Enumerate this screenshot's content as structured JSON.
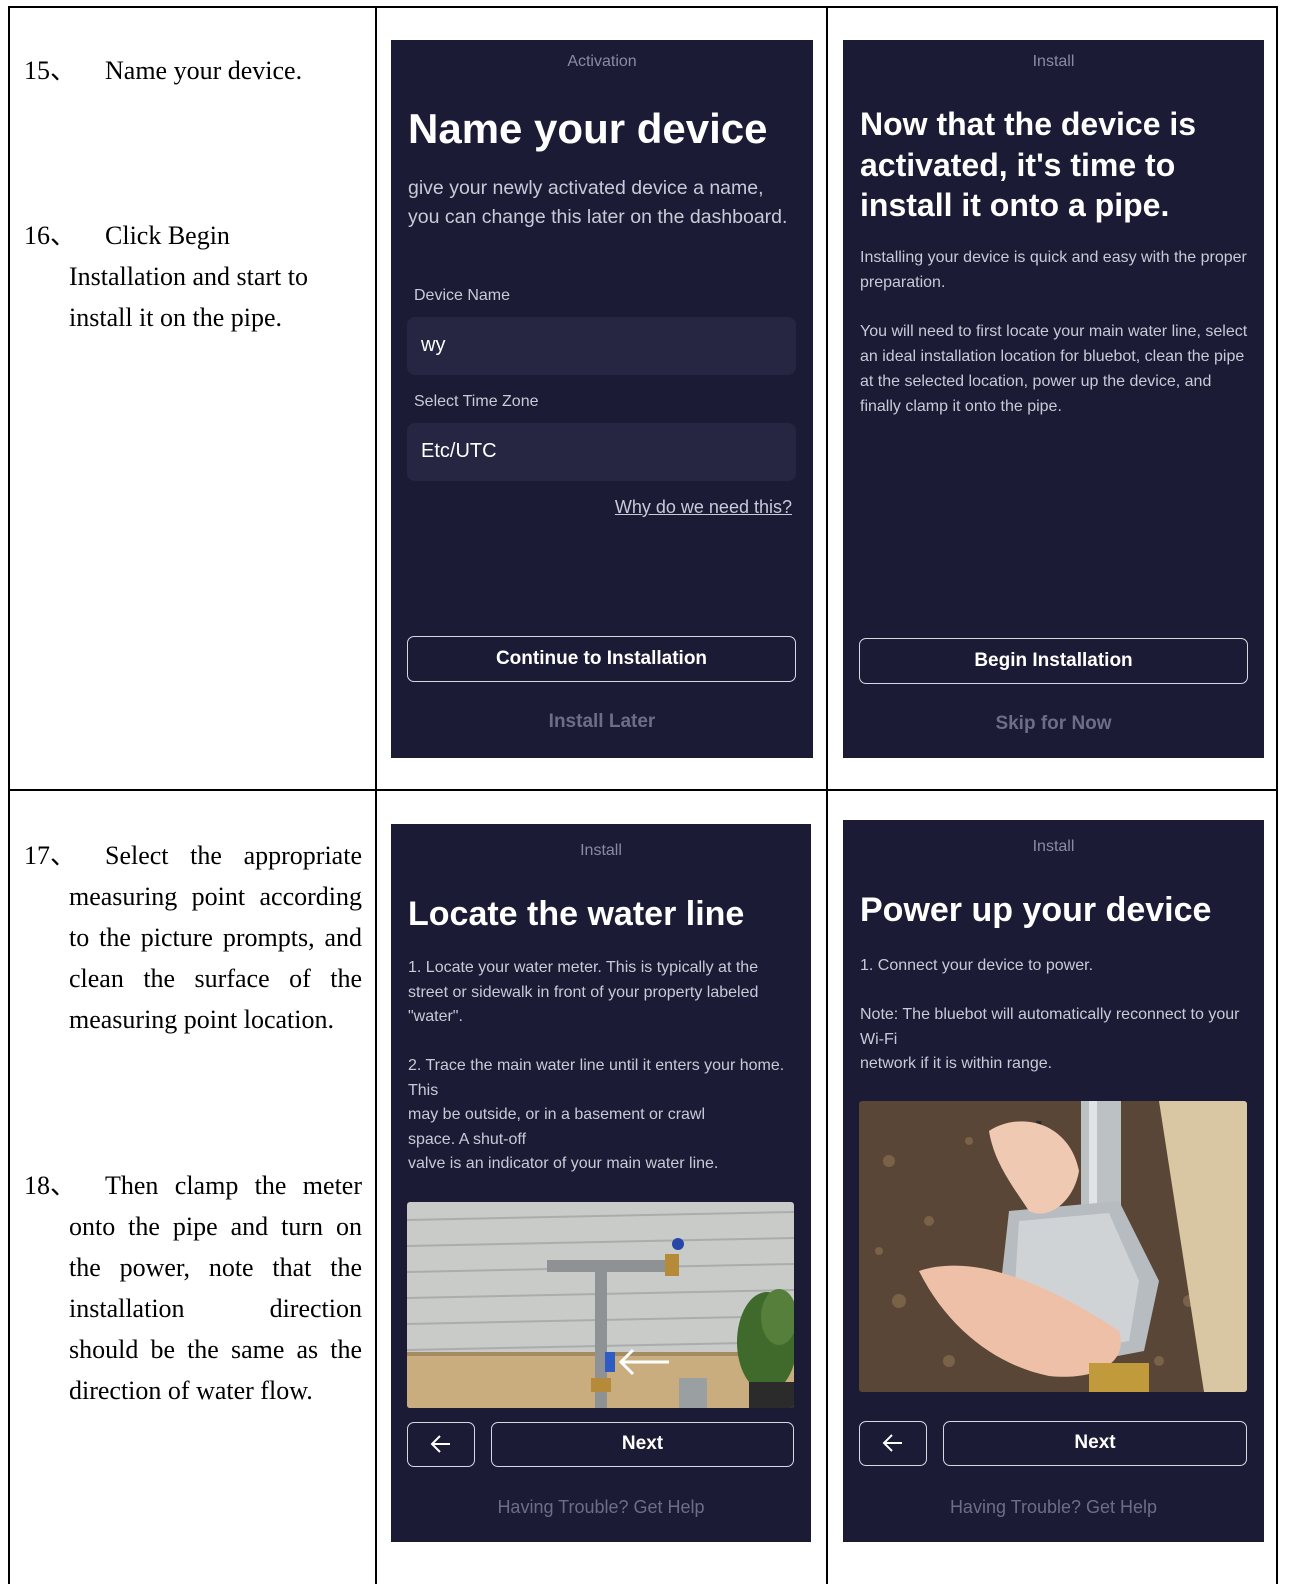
{
  "steps": {
    "s15": {
      "num": "15、",
      "text": "Name your device."
    },
    "s16": {
      "num": "16、",
      "first": "Click Begin",
      "line2": "Installation and start to",
      "line3": "install it on the pipe."
    },
    "s17": {
      "num": "17、",
      "first": "Select the appropriate",
      "line2": "measuring point according",
      "line3": "to the picture prompts, and",
      "line4": "clean the surface of the",
      "line5": "measuring point location."
    },
    "s18": {
      "num": "18、",
      "first": "Then clamp the meter",
      "line2": "onto the pipe and turn on",
      "line3": "the power, note that the",
      "line4": "installation direction",
      "line5": "should be the same as the",
      "line6": "direction of water flow."
    }
  },
  "screen_activation": {
    "header": "Activation",
    "title": "Name your device",
    "description": "give your newly activated device a name, you can change this later on the dashboard.",
    "device_name_label": "Device Name",
    "device_name_value": "wy",
    "timezone_label": "Select Time Zone",
    "timezone_value": "Etc/UTC",
    "why_link": "Why do we need this?",
    "continue_button": "Continue to Installation",
    "later_button": "Install Later"
  },
  "screen_install_intro": {
    "header": "Install",
    "title": "Now that the device is activated, it's time to install it onto a pipe.",
    "para1": "Installing your device is quick and easy with the proper preparation.",
    "para2": "You will need to first locate your main water line, select an ideal installation location for bluebot, clean the pipe at the selected location, power up the device, and finally clamp it onto the pipe.",
    "begin_button": "Begin Installation",
    "skip_button": "Skip for Now"
  },
  "screen_locate": {
    "header": "Install",
    "title": "Locate the water line",
    "para1": "1. Locate your water meter. This is typically at the street or sidewalk in front of your property labeled \"water\".",
    "para2a": "2. Trace the main water line until it enters your home. This",
    "para2b": "may be outside, or in a basement or crawl space. A shut-off",
    "para2c": "valve is an indicator of your main water line.",
    "next_button": "Next",
    "help_link": "Having Trouble? Get Help",
    "back_icon": "arrow-left-icon"
  },
  "screen_power": {
    "header": "Install",
    "title": "Power up your device",
    "para1": "1. Connect your device to power.",
    "para2a": "Note: The bluebot will automatically reconnect to your Wi-Fi",
    "para2b": "network if it is within range.",
    "next_button": "Next",
    "help_link": "Having Trouble? Get Help",
    "back_icon": "arrow-left-icon"
  },
  "colors": {
    "screen_bg": "#1b1b35",
    "field_bg": "#262642",
    "muted": "#6d6d88"
  }
}
